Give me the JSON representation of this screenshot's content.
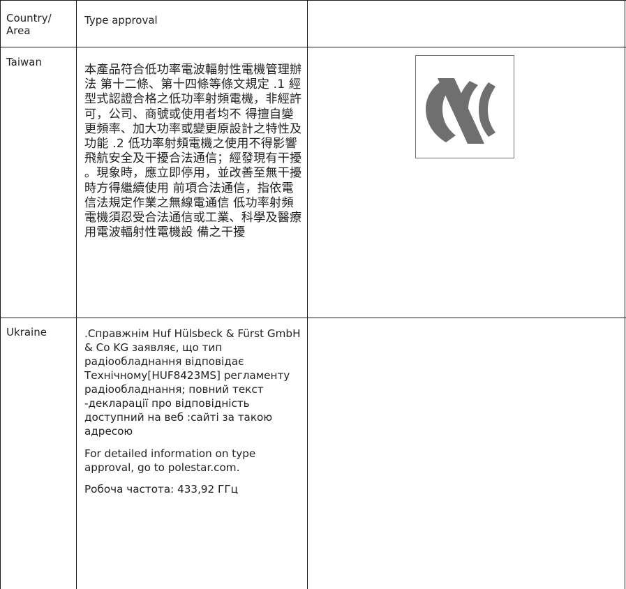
{
  "header": {
    "country_label": "Country/\nArea",
    "type_approval_label": "Type approval"
  },
  "rows": [
    {
      "country": "Taiwan",
      "text": "本產品符合低功率電波輻射性電機管理辦法 第十二條、第十四條等條文規定 .1 經型式認證合格之低功率射頻電機，非經許可，公司、商號或使用者均不 得擅自變更頻率、加大功率或變更原設計之特性及功能 .2 低功率射頻電機之使用不得影響飛航安全及干擾合法通信；經發現有干擾 。現象時，應立即停用，並改善至無干擾時方得繼續使用 前項合法通信，指依電信法規定作業之無線電通信 低功率射頻電機須忍受合法通信或工業、科學及醫療用電波輻射性電機設 備之干擾",
      "logo_icon": "ncc-logo-icon"
    },
    {
      "country": "Ukraine",
      "paragraphs": [
        ".Справжнім Huf Hülsbeck & Fürst GmbH & Co KG заявляє, що тип радіообладнання відповідає Технічному[HUF8423MS] регламенту радіообладнання; повний текст -декларації про відповідність доступний на веб :сайті за такою адресою",
        "For detailed information on type approval, go to polestar.com.",
        "Робоча частота: 433,92 ГГц"
      ]
    }
  ]
}
